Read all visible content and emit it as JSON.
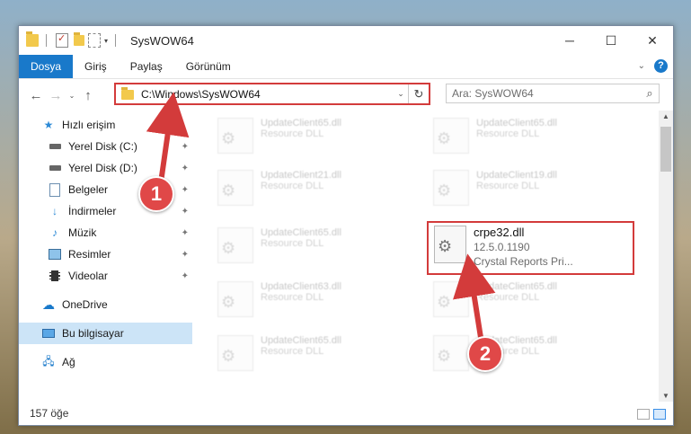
{
  "window": {
    "title": "SysWOW64",
    "controls": {
      "minimize": "─",
      "maximize": "☐",
      "close": "✕"
    }
  },
  "ribbon": {
    "tabs": [
      "Dosya",
      "Giriş",
      "Paylaş",
      "Görünüm"
    ],
    "active_tab": "Dosya",
    "expand_glyph": "⌄",
    "help_glyph": "?",
    "accent": "#1979ca"
  },
  "address": {
    "path": "C:\\Windows\\SysWOW64",
    "search_placeholder": "Ara: SysWOW64",
    "back_glyph": "←",
    "forward_glyph": "→",
    "recent_glyph": "⌄",
    "up_glyph": "↑",
    "dropdown_glyph": "⌄",
    "refresh_glyph": "↻",
    "search_glyph": "⌕"
  },
  "nav": {
    "items": [
      {
        "label": "Hızlı erişim",
        "icon": "star-icon",
        "pinned": false
      },
      {
        "label": "Yerel Disk (C:)",
        "icon": "drive-icon",
        "pinned": true
      },
      {
        "label": "Yerel Disk (D:)",
        "icon": "drive-icon",
        "pinned": true
      },
      {
        "label": "Belgeler",
        "icon": "documents-icon",
        "pinned": true
      },
      {
        "label": "İndirmeler",
        "icon": "download-icon",
        "pinned": true
      },
      {
        "label": "Müzik",
        "icon": "music-icon",
        "pinned": true
      },
      {
        "label": "Resimler",
        "icon": "pictures-icon",
        "pinned": true
      },
      {
        "label": "Videolar",
        "icon": "video-icon",
        "pinned": true
      },
      {
        "label": "OneDrive",
        "icon": "cloud-icon",
        "pinned": false
      },
      {
        "label": "Bu bilgisayar",
        "icon": "computer-icon",
        "pinned": false,
        "selected": true
      },
      {
        "label": "Ağ",
        "icon": "network-icon",
        "pinned": false
      }
    ],
    "pin_glyph": "📌"
  },
  "files": {
    "ghost": [
      {
        "name": "UpdateClient65.dll",
        "desc": "Resource DLL"
      },
      {
        "name": "UpdateClient65.dll",
        "desc": "Resource DLL"
      },
      {
        "name": "UpdateClient21.dll",
        "desc": "Resource DLL"
      },
      {
        "name": "UpdateClient19.dll",
        "desc": "Resource DLL"
      },
      {
        "name": "UpdateClient65.dll",
        "desc": "Resource DLL"
      },
      {
        "name": "UpdateClient63.dll",
        "desc": "Resource DLL"
      },
      {
        "name": "UpdateClient65.dll",
        "desc": "Resource DLL"
      },
      {
        "name": "UpdateClient65.dll",
        "desc": "Resource DLL"
      },
      {
        "name": "UpdateClient65.dll",
        "desc": "Resource DLL"
      }
    ],
    "highlighted": {
      "name": "crpe32.dll",
      "version": "12.5.0.1190",
      "desc": "Crystal Reports Pri..."
    }
  },
  "status": {
    "item_count": "157 öğe"
  },
  "annotations": {
    "step1": "1",
    "step2": "2",
    "color": "#d33b3b"
  }
}
